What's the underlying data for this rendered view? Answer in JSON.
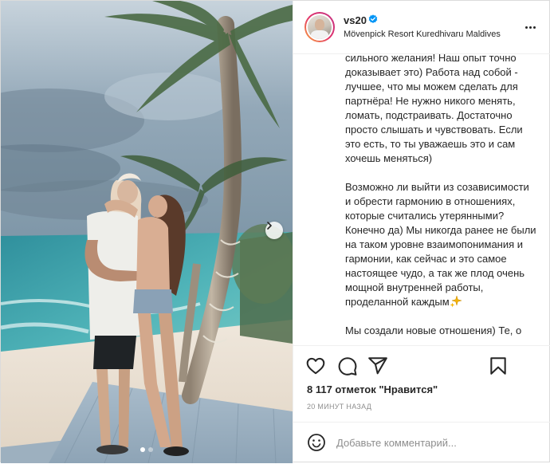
{
  "post": {
    "username": "vs20",
    "verified": true,
    "location": "Mövenpick Resort Kuredhivaru Maldives",
    "caption": "сильного желания! Наш опыт точно доказывает это) Работа над собой - лучшее, что мы можем сделать для партнёра! Не нужно никого менять, ломать, подстраивать. Достаточно просто слышать и чувствовать. Если это есть, то ты уважаешь это и сам хочешь меняться)\n\nВозможно ли выйти из созависимости и обрести гармонию в отношениях, которые считались утерянными? Конечно да) Мы никогда ранее не были на таком уровне взаимопонимания и гармонии, как сейчас и это самое настоящее чудо, а так же плод очень мощной внутренней работы, проделанной каждым",
    "caption_end_icon": "sparkles-emoji",
    "caption_next": "Мы создали новые отношения) Те, о",
    "likes_text": "8 117 отметок \"Нравится\"",
    "time_text": "20 МИНУТ НАЗАД",
    "comment_placeholder": "Добавьте комментарий...",
    "carousel": {
      "total": 2,
      "current": 1
    }
  },
  "icons": {
    "like": "heart-icon",
    "comment": "comment-icon",
    "share": "paper-plane-icon",
    "save": "bookmark-icon",
    "emoji": "emoji-smile-icon",
    "more": "more-dots-icon",
    "next": "chevron-right-icon",
    "verified": "verified-badge-icon"
  },
  "colors": {
    "text": "#262626",
    "secondary": "#8e8e8e",
    "verified": "#0095f6",
    "divider": "#efefef"
  }
}
